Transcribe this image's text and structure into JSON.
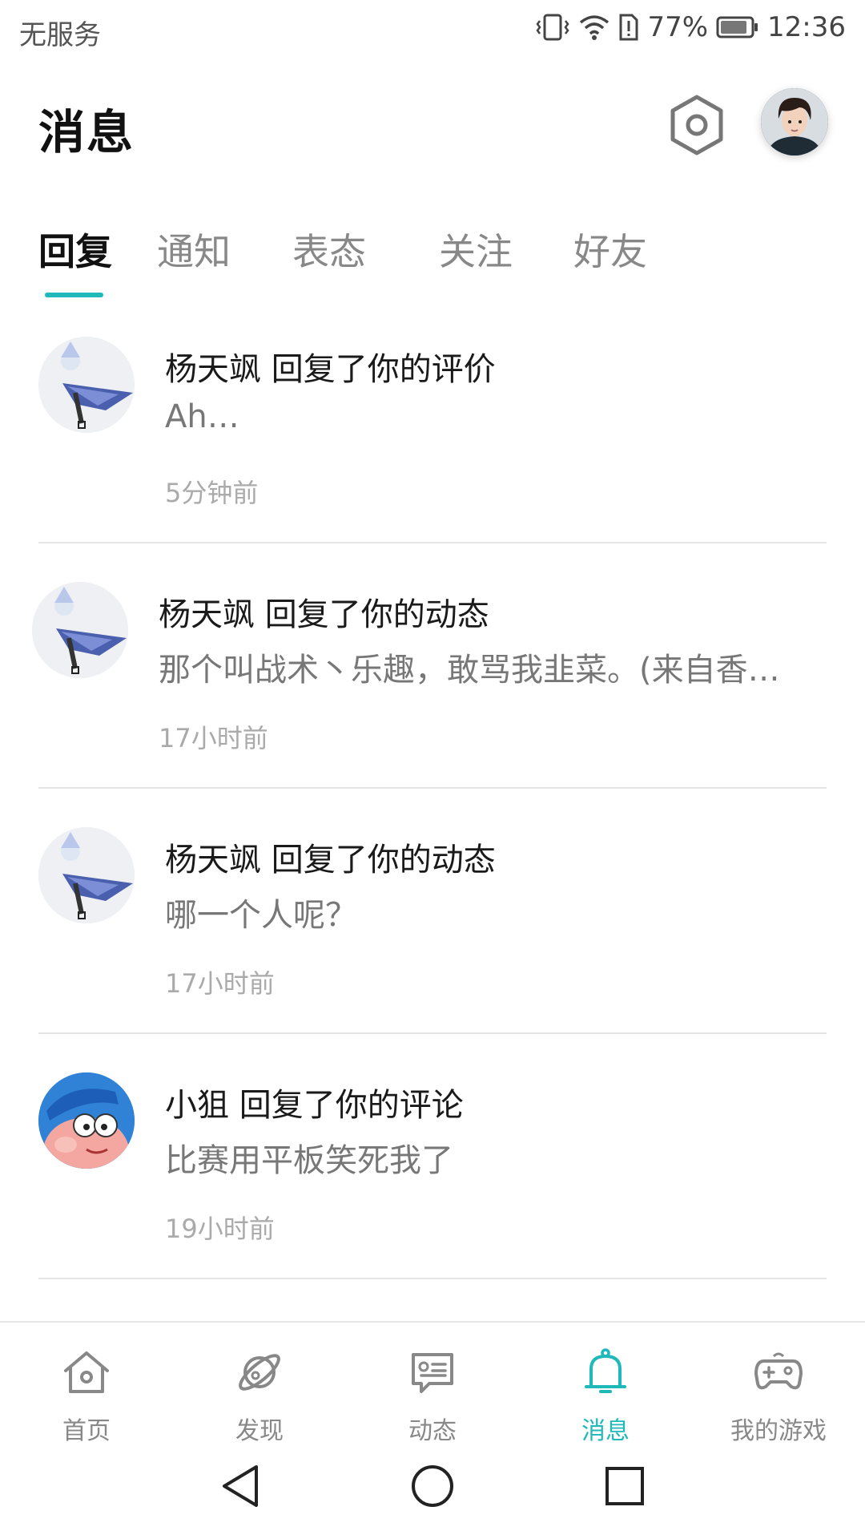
{
  "status_bar": {
    "carrier": "无服务",
    "battery": "77%",
    "time": "12:36"
  },
  "header": {
    "title": "消息"
  },
  "tabs": [
    {
      "label": "回复",
      "active": true
    },
    {
      "label": "通知",
      "active": false
    },
    {
      "label": "表态",
      "active": false
    },
    {
      "label": "关注",
      "active": false
    },
    {
      "label": "好友",
      "active": false
    }
  ],
  "messages": [
    {
      "title": "杨天飒 回复了你的评价",
      "body": "Ah…",
      "time": "5分钟前"
    },
    {
      "title": "杨天飒 回复了你的动态",
      "body": "那个叫战术丶乐趣，敢骂我韭菜。(来自香…",
      "time": "17小时前"
    },
    {
      "title": "杨天飒 回复了你的动态",
      "body": "哪一个人呢？",
      "time": "17小时前"
    },
    {
      "title": "小狙 回复了你的评论",
      "body": "比赛用平板笑死我了",
      "time": "19小时前"
    }
  ],
  "bottom_nav": [
    {
      "label": "首页",
      "icon": "home-icon",
      "active": false
    },
    {
      "label": "发现",
      "icon": "planet-icon",
      "active": false
    },
    {
      "label": "动态",
      "icon": "chat-card-icon",
      "active": false
    },
    {
      "label": "消息",
      "icon": "bell-icon",
      "active": true
    },
    {
      "label": "我的游戏",
      "icon": "gamepad-icon",
      "active": false
    }
  ],
  "colors": {
    "accent": "#1fb9b9",
    "text_primary": "#1a1a1a",
    "text_secondary": "#777777",
    "text_muted": "#aaaaaa"
  }
}
